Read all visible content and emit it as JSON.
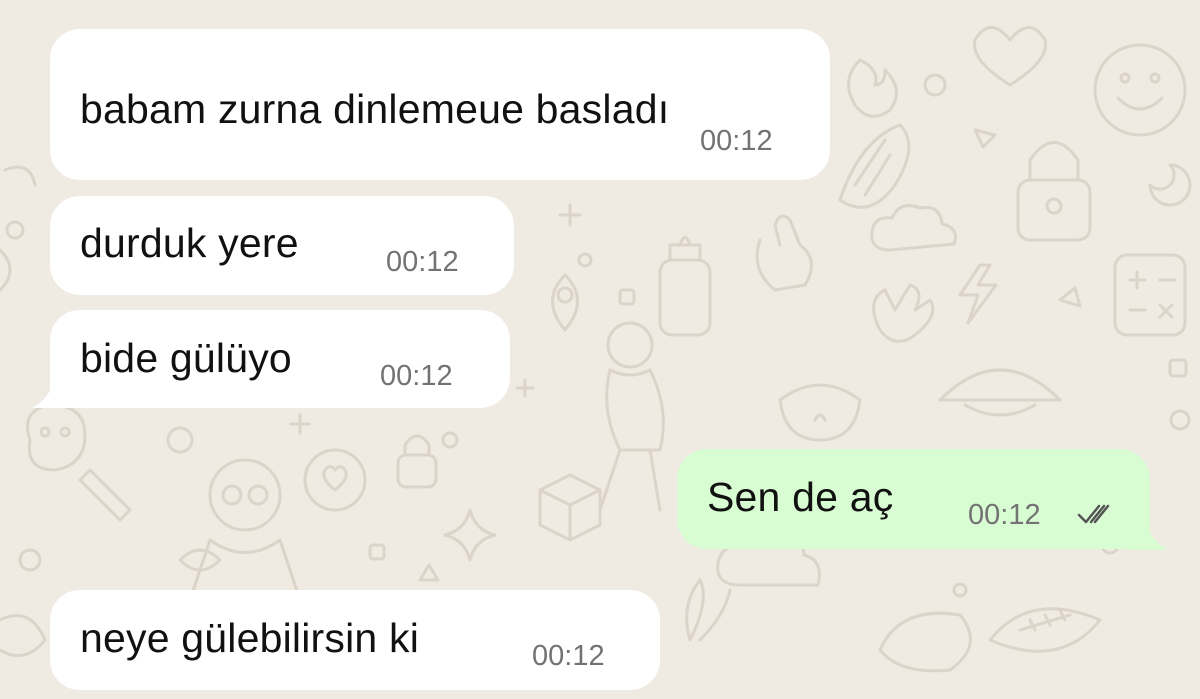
{
  "chat": {
    "messages": [
      {
        "direction": "incoming",
        "text": "babam zurna dinlemeue basladı",
        "time": "00:12"
      },
      {
        "direction": "incoming",
        "text": "durduk yere",
        "time": "00:12"
      },
      {
        "direction": "incoming",
        "text": "bide gülüyo",
        "time": "00:12"
      },
      {
        "direction": "outgoing",
        "text": "Sen de aç",
        "time": "00:12",
        "status_icon": "double-check-icon",
        "status": "read"
      },
      {
        "direction": "incoming",
        "text": "neye gülebilirsin ki",
        "time": "00:12"
      }
    ]
  },
  "colors": {
    "background": "#efeae2",
    "incoming_bubble": "#ffffff",
    "outgoing_bubble": "#d9fdd3",
    "timestamp": "#737373",
    "doodle": "#dcd4c8"
  }
}
